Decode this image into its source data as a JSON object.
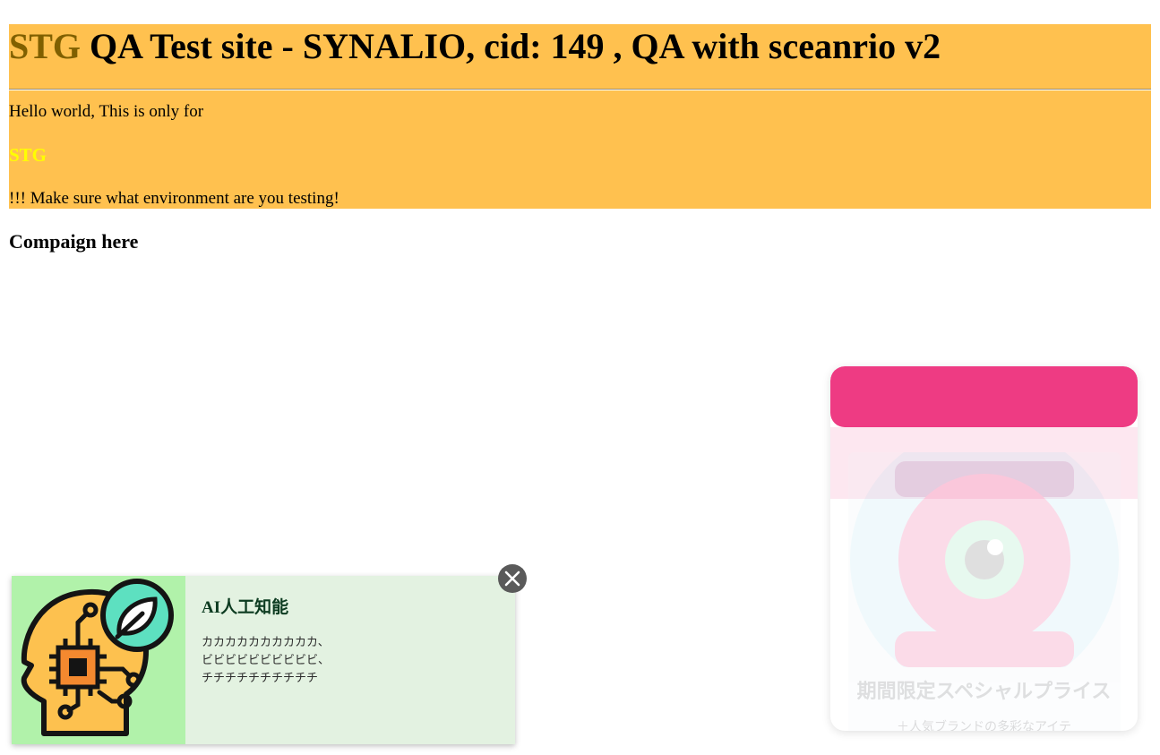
{
  "banner": {
    "env_label": "STG",
    "title_rest": " QA Test site - SYNALIO, cid: 149 , QA with sceanrio v2",
    "line1": "Hello world, This is only for",
    "env_strong": "STG",
    "line2": "!!! Make sure what environment are you testing!"
  },
  "campaign": {
    "heading": "Compaign here"
  },
  "popup_right": {
    "title": "期間限定スペシャルプライス",
    "subtitle": "＋人気ブランドの多彩なアイテ",
    "header_color": "#ee3b83"
  },
  "popup_left": {
    "heading": "AI人工知能",
    "desc_lines": [
      "カカカカカカカカカカ、",
      "ビビビビビビビビビビ、",
      "チチチチチチチチチチ"
    ],
    "image_icon": "ai-head-icon",
    "close_icon": "close-icon"
  }
}
